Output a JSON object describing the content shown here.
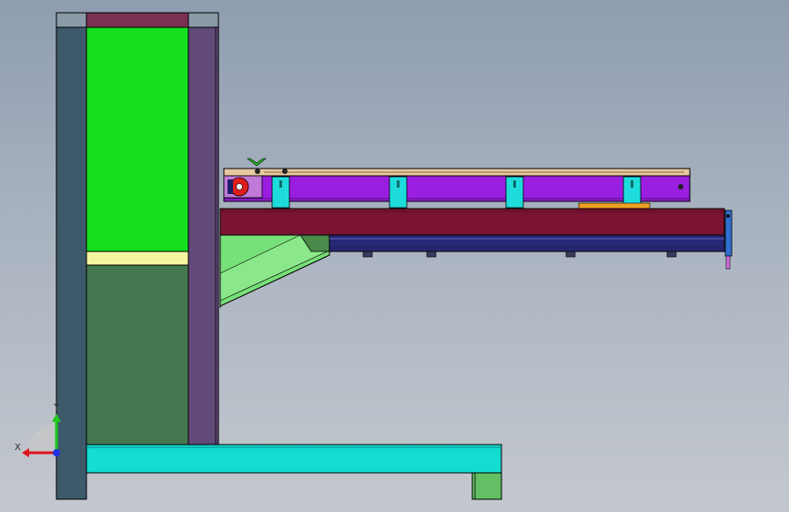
{
  "view": {
    "background_top": "#8f9db1",
    "background_bottom": "#c4c8ce"
  },
  "triad": {
    "x_label": "X",
    "y_label": "Y",
    "x_color": "#e0141e",
    "y_color": "#1ec81e",
    "z_color": "#1e32e6"
  },
  "colors": {
    "column_outer": "#3d5a6b",
    "column_green_top": "#14e01e",
    "column_band": "#f5f5a0",
    "column_green_bottom": "#467850",
    "column_purple": "#614a7a",
    "column_cap": "#7a3050",
    "base_beam": "#14dcd2",
    "base_foot": "#64c064",
    "arm_top_rail": "#e8c8a0",
    "arm_purple": "#9a1ee0",
    "arm_cyan_block": "#1edcdc",
    "arm_red_beam": "#7a1432",
    "arm_navy": "#282878",
    "bracket_light": "#78e078",
    "bracket_dark": "#4a8a4a",
    "gear_red": "#e01e1e",
    "orange_strip": "#f0a020",
    "edge": "#000000"
  }
}
